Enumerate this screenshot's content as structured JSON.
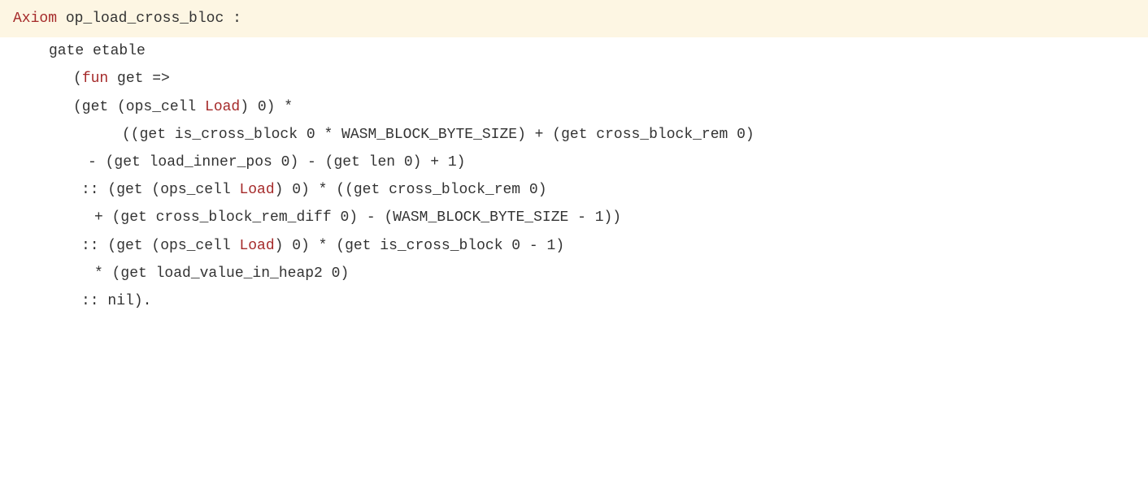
{
  "code": {
    "line1": {
      "keyword": "Axiom",
      "name": "op_load_cross_bloc",
      "colon": ":"
    },
    "line2": "gate etable",
    "line3": {
      "open": "(",
      "keyword": "fun",
      "rest": " get =>"
    },
    "line4": {
      "prefix": "(get (ops_cell ",
      "load": "Load",
      "suffix": ") 0) *"
    },
    "line5": "((get is_cross_block 0 * WASM_BLOCK_BYTE_SIZE) + (get cross_block_rem 0)",
    "line6": "- (get load_inner_pos 0) - (get len 0) + 1)",
    "line7": {
      "prefix": ":: (get (ops_cell ",
      "load": "Load",
      "suffix": ") 0) * ((get cross_block_rem 0)"
    },
    "line8": "+ (get cross_block_rem_diff 0) - (WASM_BLOCK_BYTE_SIZE - 1))",
    "line9": {
      "prefix": ":: (get (ops_cell ",
      "load": "Load",
      "suffix": ") 0) * (get is_cross_block 0 - 1)"
    },
    "line10": "* (get load_value_in_heap2 0)",
    "line11": ":: nil)."
  }
}
